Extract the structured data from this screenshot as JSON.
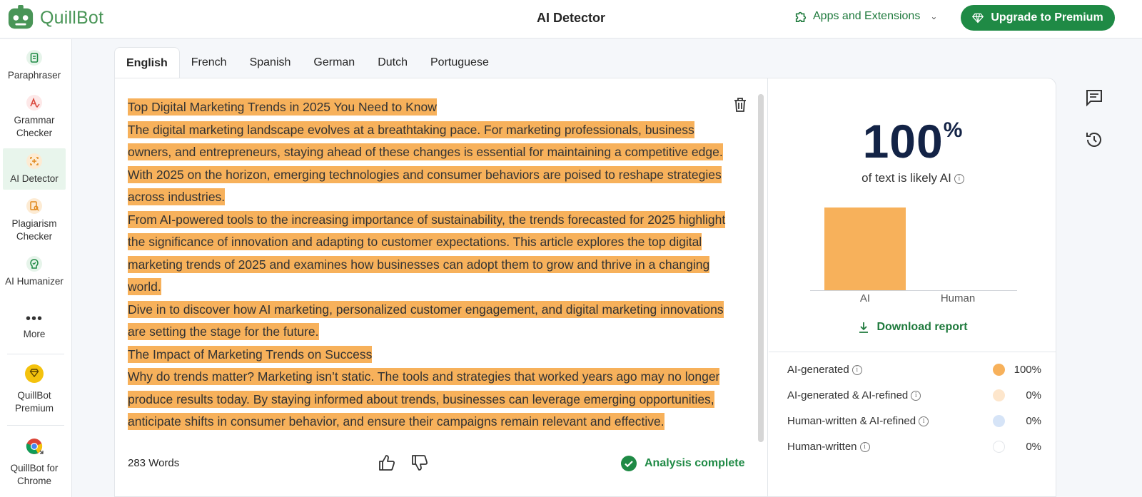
{
  "header": {
    "brand": "QuillBot",
    "title": "AI Detector",
    "apps_label": "Apps and Extensions",
    "upgrade_label": "Upgrade to Premium"
  },
  "sidebar": {
    "items": [
      {
        "label": "Paraphraser",
        "icon": "paraphraser-icon"
      },
      {
        "label": "Grammar Checker",
        "icon": "grammar-icon"
      },
      {
        "label": "AI Detector",
        "icon": "ai-detector-icon"
      },
      {
        "label": "Plagiarism Checker",
        "icon": "plagiarism-icon"
      },
      {
        "label": "AI Humanizer",
        "icon": "humanizer-icon"
      },
      {
        "label": "More",
        "icon": "more-icon"
      },
      {
        "label": "QuillBot Premium",
        "icon": "premium-diamond-icon"
      },
      {
        "label": "QuillBot for Chrome",
        "icon": "chrome-icon"
      }
    ]
  },
  "tabs": [
    "English",
    "French",
    "Spanish",
    "German",
    "Dutch",
    "Portuguese"
  ],
  "active_tab": "English",
  "editor": {
    "paragraphs": [
      "Top Digital Marketing Trends in 2025 You Need to Know",
      "The digital marketing landscape evolves at a breathtaking pace. For marketing professionals, business owners, and entrepreneurs, staying ahead of these changes is essential for maintaining a competitive edge. With 2025 on the horizon, emerging technologies and consumer behaviors are poised to reshape strategies across industries.",
      "From AI-powered tools to the increasing importance of sustainability, the trends forecasted for 2025 highlight the significance of innovation and adapting to customer expectations. This article explores the top digital marketing trends of 2025 and examines how businesses can adopt them to grow and thrive in a changing world.",
      "Dive in to discover how AI marketing, personalized customer engagement, and digital marketing innovations are setting the stage for the future.",
      "The Impact of Marketing Trends on Success",
      "Why do trends matter? Marketing isn’t static. The tools and strategies that worked years ago may no longer produce results today. By staying informed about trends, businesses can leverage emerging opportunities, anticipate shifts in consumer behavior, and ensure their campaigns remain relevant and effective."
    ],
    "word_count": "283 Words",
    "status": "Analysis complete"
  },
  "results": {
    "percent": "100",
    "percent_sign": "%",
    "caption": "of text is likely AI",
    "download_label": "Download report",
    "breakdown": [
      {
        "label": "AI-generated",
        "value": "100%",
        "color": "#f7b15b"
      },
      {
        "label": "AI-generated & AI-refined",
        "value": "0%",
        "color": "#fde6cc"
      },
      {
        "label": "Human-written & AI-refined",
        "value": "0%",
        "color": "#d6e4f7"
      },
      {
        "label": "Human-written",
        "value": "0%",
        "color": "#ffffff"
      }
    ]
  },
  "chart_data": {
    "type": "bar",
    "categories": [
      "AI",
      "Human"
    ],
    "values": [
      100,
      0
    ],
    "ylim": [
      0,
      100
    ],
    "color": "#f7b15b"
  },
  "colors": {
    "brand_green": "#1f8a45",
    "highlight": "#f7b15b",
    "score_text": "#132346"
  }
}
